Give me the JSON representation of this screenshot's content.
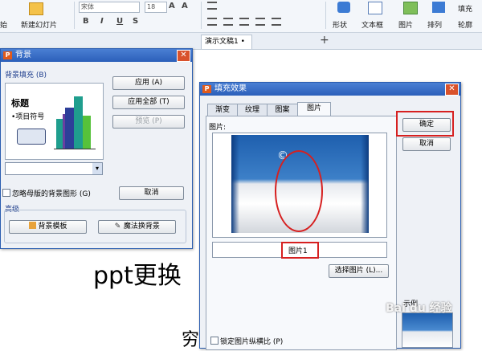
{
  "ribbon": {
    "left_labels": [
      "始",
      "新建幻灯片"
    ],
    "font_name": "宋体",
    "font_size": "18",
    "format_buttons": [
      "B",
      "I",
      "U",
      "S"
    ],
    "right_labels": [
      "形状",
      "文本框",
      "图片",
      "排列",
      "轮廓"
    ],
    "right_top_label": "填充"
  },
  "tabbar": {
    "doc_tab": "演示文稿1 •",
    "plus": "+"
  },
  "slide": {
    "text1": "ppt更换",
    "text2": "穷"
  },
  "background_dialog": {
    "title": "背景",
    "fill_section": "背景填充 (B)",
    "preview_title": "标题",
    "preview_bullet": "•项目符号",
    "apply": "应用 (A)",
    "apply_all": "应用全部 (T)",
    "preview_btn": "预览 (P)",
    "ignore_master": "忽略母版的背景图形 (G)",
    "cancel": "取消",
    "advanced": "高级",
    "bg_template": "背景模板",
    "magic_bg": "魔法换背景"
  },
  "fill_dialog": {
    "title": "填充效果",
    "tabs": [
      "渐变",
      "纹理",
      "图案",
      "图片"
    ],
    "active_tab": 3,
    "picture_label": "图片:",
    "picture_name": "图片1",
    "select_picture": "选择图片 (L)...",
    "ok": "确定",
    "cancel": "取消",
    "lock_ratio": "锁定图片纵横比 (P)",
    "sample_label": "示例"
  },
  "watermark": "Bai du 经验",
  "colors": {
    "title_bar": "#2b5fba",
    "highlight": "#d62020",
    "bar_teal": "#1f9e8e",
    "bar_blue": "#2d3f99",
    "bar_green": "#56c23a",
    "bar_purple": "#6a3fa0"
  }
}
